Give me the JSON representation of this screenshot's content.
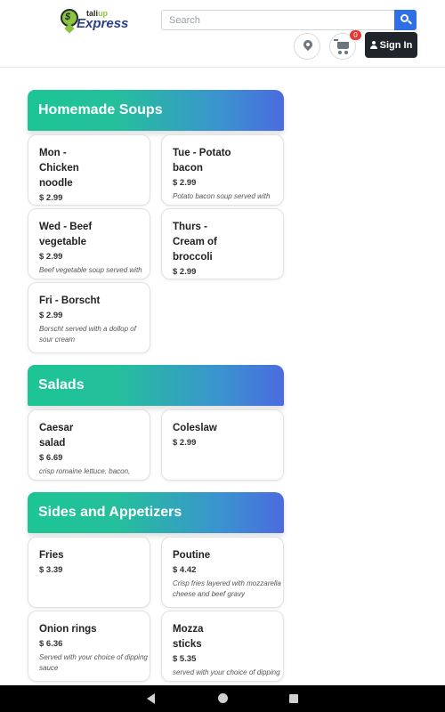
{
  "header": {
    "logo_small_prefix": "tali",
    "logo_small_suffix": "up",
    "logo_main": "Express",
    "search_placeholder": "Search",
    "cart_count": "0",
    "signin_label": "Sign In"
  },
  "sections": [
    {
      "title": "Homemade Soups",
      "items": [
        {
          "name": "Mon - Chicken noodle",
          "price": "$ 2.99",
          "desc": ""
        },
        {
          "name": "Tue - Potato bacon",
          "price": "$ 2.99",
          "desc": "Potato bacon soup served with"
        },
        {
          "name": "Wed - Beef vegetable",
          "price": "$ 2.99",
          "desc": "Beef vegetable soup served with"
        },
        {
          "name": "Thurs - Cream of broccoli",
          "price": "$ 2.99",
          "desc": ""
        },
        {
          "name": "Fri - Borscht",
          "price": "$ 2.99",
          "desc": "Borscht served with a dollop of sour cream"
        }
      ]
    },
    {
      "title": "Salads",
      "items": [
        {
          "name": "Caesar salad",
          "price": "$ 6.69",
          "desc": "crisp romaine lettuce, bacon,"
        },
        {
          "name": "Coleslaw",
          "price": "$ 2.99",
          "desc": ""
        }
      ]
    },
    {
      "title": "Sides and Appetizers",
      "items": [
        {
          "name": "Fries",
          "price": "$ 3.39",
          "desc": ""
        },
        {
          "name": "Poutine",
          "price": "$ 4.42",
          "desc": "Crisp fries layered with mozzarella cheese and beef gravy"
        },
        {
          "name": "Onion rings",
          "price": "$ 6.36",
          "desc": "Served with your choice of dipping sauce"
        },
        {
          "name": "Mozza sticks",
          "price": "$ 5.35",
          "desc": "served with your choice of dipping"
        }
      ]
    }
  ]
}
